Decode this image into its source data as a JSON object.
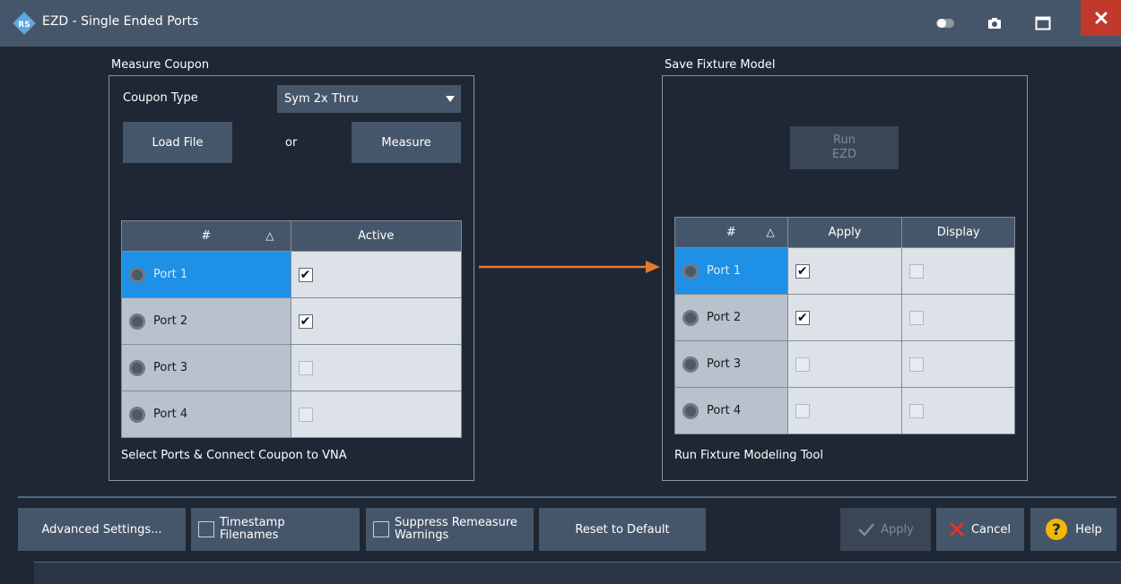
{
  "window": {
    "title": "EZD - Single Ended Ports"
  },
  "measure": {
    "title": "Measure Coupon",
    "coupon_type_label": "Coupon Type",
    "coupon_type_value": "Sym 2x Thru",
    "load_file": "Load File",
    "or": "or",
    "measure": "Measure",
    "col_num": "#",
    "col_active": "Active",
    "rows": [
      {
        "port": "Port 1",
        "active": true,
        "selected": true
      },
      {
        "port": "Port 2",
        "active": true,
        "selected": false
      },
      {
        "port": "Port 3",
        "active": false,
        "selected": false
      },
      {
        "port": "Port 4",
        "active": false,
        "selected": false
      }
    ],
    "hint": "Select Ports & Connect Coupon to VNA"
  },
  "save": {
    "title": "Save Fixture Model",
    "run_line1": "Run",
    "run_line2": "EZD",
    "col_num": "#",
    "col_apply": "Apply",
    "col_display": "Display",
    "rows": [
      {
        "port": "Port 1",
        "apply": true,
        "display": false,
        "selected": true
      },
      {
        "port": "Port 2",
        "apply": true,
        "display": false,
        "selected": false
      },
      {
        "port": "Port 3",
        "apply": false,
        "display": false,
        "selected": false
      },
      {
        "port": "Port 4",
        "apply": false,
        "display": false,
        "selected": false
      }
    ],
    "hint": "Run Fixture Modeling Tool"
  },
  "footer": {
    "advanced": "Advanced Settings...",
    "timestamp_line1": "Timestamp",
    "timestamp_line2": "Filenames",
    "suppress_line1": "Suppress Remeasure",
    "suppress_line2": "Warnings",
    "reset": "Reset to Default",
    "apply": "Apply",
    "cancel": "Cancel",
    "help": "Help"
  },
  "colors": {
    "accent_selected": "#1e90e6",
    "arrow": "#e07a2e",
    "close": "#c0392b",
    "help_icon": "#f2b705",
    "cancel_icon": "#e8322a"
  }
}
